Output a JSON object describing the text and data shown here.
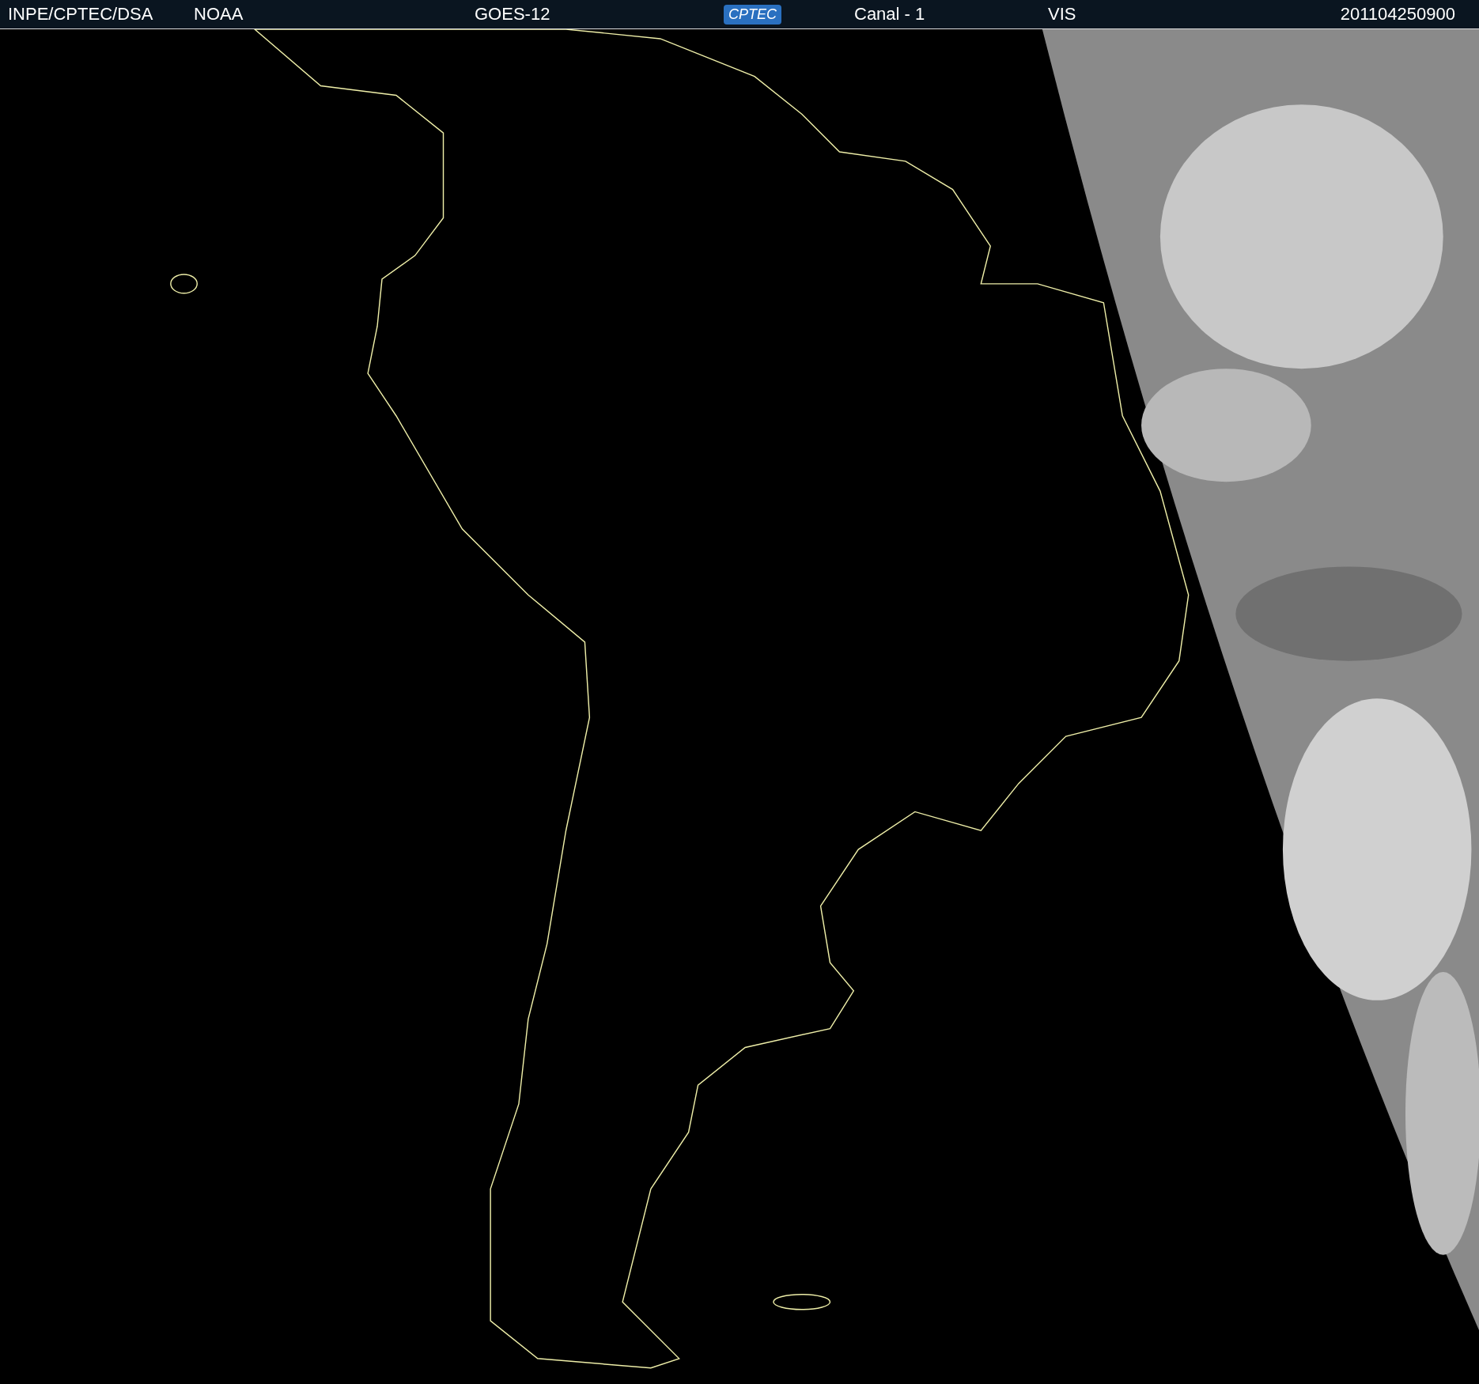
{
  "header": [
    {
      "kind": "text",
      "text": "INPE/CPTEC/DSA"
    },
    {
      "kind": "text",
      "text": "NOAA"
    },
    {
      "kind": "text",
      "text": "GOES-12"
    },
    {
      "kind": "logo",
      "text": "CPTEC"
    },
    {
      "kind": "text",
      "text": "Canal - 1"
    },
    {
      "kind": "text",
      "text": "VIS"
    },
    {
      "kind": "text",
      "text": "201104250900"
    }
  ]
}
